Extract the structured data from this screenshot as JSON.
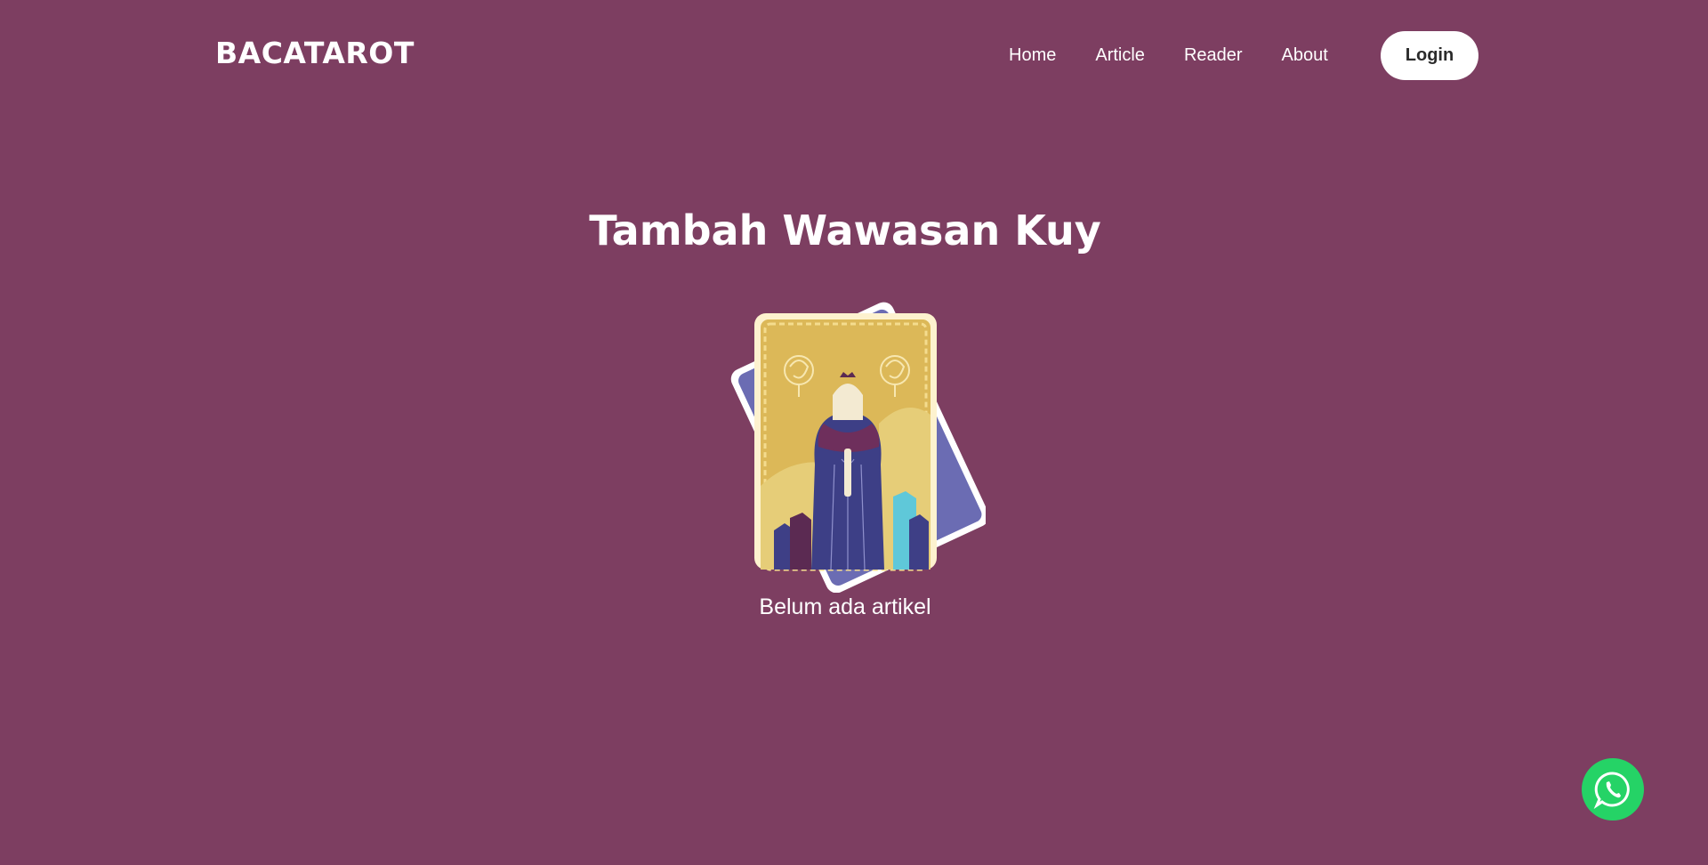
{
  "header": {
    "brand": "BACATAROT",
    "nav": [
      "Home",
      "Article",
      "Reader",
      "About"
    ],
    "login_label": "Login"
  },
  "main": {
    "headline": "Tambah Wawasan Kuy",
    "empty_message": "Belum ada artikel"
  },
  "floating": {
    "whatsapp_icon": "whatsapp-icon"
  },
  "colors": {
    "background": "#7d3e61",
    "card_back": "#6b6cb3",
    "card_front": "#e0bf5a",
    "whatsapp": "#25d366"
  }
}
